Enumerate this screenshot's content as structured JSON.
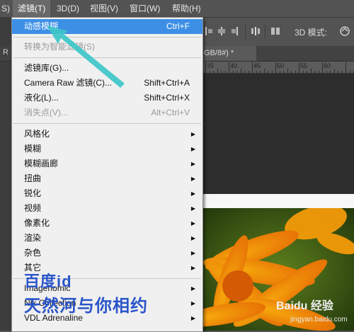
{
  "menubar": {
    "items": [
      {
        "label": "S)"
      },
      {
        "label": "滤镜(T)"
      },
      {
        "label": "3D(D)"
      },
      {
        "label": "视图(V)"
      },
      {
        "label": "窗口(W)"
      },
      {
        "label": "帮助(H)"
      }
    ]
  },
  "options": {
    "mode_label": "3D 模式:"
  },
  "tabs": {
    "left_fragment": "R",
    "doc_tab": "GB/8#) *"
  },
  "ruler": {
    "labels": [
      "35",
      "40",
      "45",
      "50",
      "55",
      "60"
    ]
  },
  "filter_menu": {
    "items": [
      {
        "label": "动感模糊",
        "shortcut": "Ctrl+F"
      },
      {
        "label": "转换为智能滤镜(S)",
        "disabled": true
      },
      {
        "label": "滤镜库(G)..."
      },
      {
        "label": "Camera Raw 滤镜(C)...",
        "shortcut": "Shift+Ctrl+A"
      },
      {
        "label": "液化(L)...",
        "shortcut": "Shift+Ctrl+X"
      },
      {
        "label": "消失点(V)...",
        "shortcut": "Alt+Ctrl+V",
        "disabled": true
      },
      {
        "label": "风格化"
      },
      {
        "label": "模糊"
      },
      {
        "label": "模糊画廊"
      },
      {
        "label": "扭曲"
      },
      {
        "label": "锐化"
      },
      {
        "label": "视频"
      },
      {
        "label": "像素化"
      },
      {
        "label": "渲染"
      },
      {
        "label": "杂色"
      },
      {
        "label": "其它"
      },
      {
        "label": "Imagenomic"
      },
      {
        "label": "Nik Collection"
      },
      {
        "label": "VDL Adrenaline"
      }
    ]
  },
  "watermark": {
    "line1": "百度id",
    "line2": "天然河与你相约",
    "brand": "Baidu 经验",
    "site": "jingyan.baidu.com"
  },
  "colors": {
    "highlight": "#3d8fe6",
    "arrow": "#3ec6c8",
    "watermark": "#2a55c9"
  }
}
